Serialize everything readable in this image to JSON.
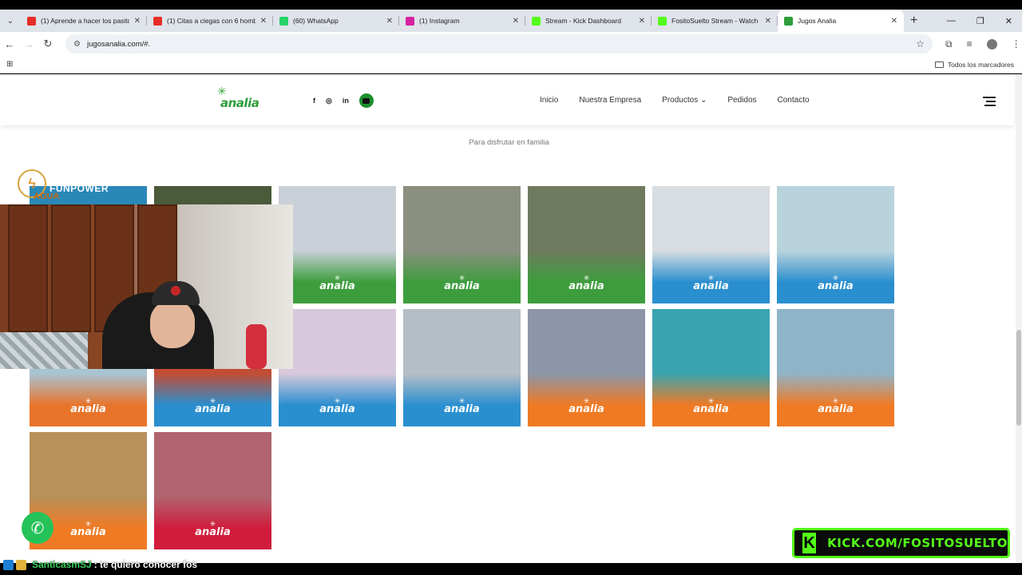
{
  "tabs": [
    {
      "title": "(1) Aprende a hacer los pasitos",
      "icon": "youtube-icon",
      "color": "#e52d27"
    },
    {
      "title": "(1) Citas a ciegas con 6 hombres",
      "icon": "youtube-icon",
      "color": "#e52d27"
    },
    {
      "title": "(60) WhatsApp",
      "icon": "whatsapp-icon",
      "color": "#25d366"
    },
    {
      "title": "(1) Instagram",
      "icon": "instagram-icon",
      "color": "#d6249f"
    },
    {
      "title": "Stream - Kick Dashboard",
      "icon": "kick-icon",
      "color": "#53fc18"
    },
    {
      "title": "FositoSuelto Stream - Watch Live",
      "icon": "kick-icon",
      "color": "#53fc18"
    },
    {
      "title": "Jugos Analia",
      "icon": "analia-icon",
      "color": "#2e9e3a",
      "active": true
    }
  ],
  "url": "jugosanalia.com/#.",
  "bookmarks_label": "Todos los marcadores",
  "site": {
    "logo_text": "analia",
    "social": [
      "f",
      "◎",
      "in"
    ],
    "nav": [
      "Inicio",
      "Nuestra Empresa",
      "Productos",
      "Pedidos",
      "Contacto"
    ],
    "subtitle": "Para disfrutar en familia"
  },
  "gallery_logo": "analia",
  "tiles": [
    {
      "top": "#2a88b8",
      "bottom": "#1f86c4"
    },
    {
      "top": "#4a5a3a",
      "bottom": "#3c9a3c"
    },
    {
      "top": "#c9d0d8",
      "bottom": "#3d9d3d"
    },
    {
      "top": "#8a8f80",
      "bottom": "#3d9d3d"
    },
    {
      "top": "#6f7a5e",
      "bottom": "#3d9d3d"
    },
    {
      "top": "#d8dde2",
      "bottom": "#2a8fcf"
    },
    {
      "top": "#b9d3dc",
      "bottom": "#2a8fcf"
    },
    {
      "top": "#a8c4d2",
      "bottom": "#e8742a"
    },
    {
      "top": "#c24d35",
      "bottom": "#2a8fcf"
    },
    {
      "top": "#d7c8dc",
      "bottom": "#2a8fcf"
    },
    {
      "top": "#b5bec6",
      "bottom": "#2a8fcf"
    },
    {
      "top": "#8c96a8",
      "bottom": "#f07a24"
    },
    {
      "top": "#3aa4b0",
      "bottom": "#f07a24"
    },
    {
      "top": "#8fb4c8",
      "bottom": "#f07a24"
    },
    {
      "top": "#b7905a",
      "bottom": "#f07a24"
    },
    {
      "top": "#b0646e",
      "bottom": "#d11c3c"
    }
  ],
  "sponsor": {
    "brand": "FUNPOWER",
    "line2": "AGUA"
  },
  "stream": {
    "kick_banner": "KICK.COM/FOSITOSUELTO",
    "chat_user": "SanticasmSJ",
    "chat_msg": ": te quiero conocer fos"
  }
}
